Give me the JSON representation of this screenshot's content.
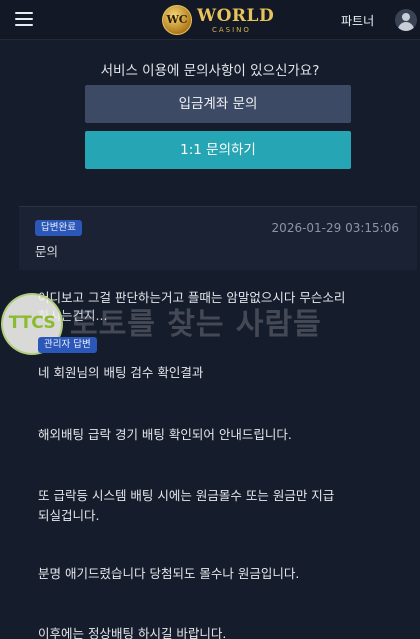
{
  "header": {
    "menu_icon": "hamburger-icon",
    "logo_badge": "WC",
    "logo_title": "WORLD",
    "logo_subtitle": "CASINO",
    "partner_label": "파트너",
    "user_icon": "user-icon"
  },
  "support": {
    "question": "서비스 이용에 문의사항이 있으신가요?",
    "deposit_button": "입금계좌 문의",
    "inquiry_button": "1:1 문의하기"
  },
  "ticket": {
    "status_badge": "답변완료",
    "datetime": "2026-01-29 03:15:06",
    "title": "문의",
    "question_lines": [
      "어디보고 그걸 판단하는거고 플때는 암말없으시다 무슨소리",
      "하시는건지..."
    ],
    "answer_badge": "관리자 답변",
    "answer_lines": [
      "네 회원님의 배팅 검수 확인결과",
      "해외배팅 급락 경기 배팅 확인되어 안내드립니다.",
      "또 급락등 시스템 배팅 시에는 원금몰수 또는 원금만 지급",
      "되실겁니다.",
      "분명 애기드렸습니다 당첨되도 몰수나 원금입니다.",
      "이후에는 정상배팅 하시길 바랍니다."
    ]
  },
  "watermark": {
    "logo_text": "TTCS",
    "text": "토토를 찾는 사람들"
  }
}
